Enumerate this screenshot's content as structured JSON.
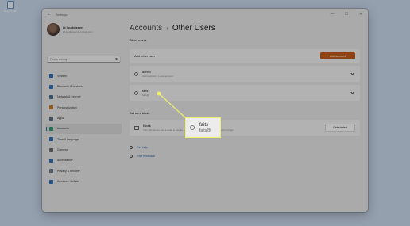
{
  "desktop": {
    "recycle_bin_label": "Recycle Bin",
    "recycle_bin_icon": "recycle-bin-icon"
  },
  "window": {
    "title": "Settings",
    "controls": {
      "minimize": "—",
      "maximize": "☐",
      "close": "✕"
    },
    "back": "←"
  },
  "profile": {
    "name": "jd loudoizeen",
    "email": "jdl.loudoizeen@outlook.com"
  },
  "search": {
    "placeholder": "Find a setting"
  },
  "nav": {
    "items": [
      {
        "label": "System",
        "icon": "monitor-icon",
        "color": "#2e6fb5"
      },
      {
        "label": "Bluetooth & devices",
        "icon": "bluetooth-icon",
        "color": "#2e6fb5"
      },
      {
        "label": "Network & internet",
        "icon": "wifi-icon",
        "color": "#4a6b8a"
      },
      {
        "label": "Personalization",
        "icon": "brush-icon",
        "color": "#c07a2a"
      },
      {
        "label": "Apps",
        "icon": "apps-icon",
        "color": "#5a6b7c"
      },
      {
        "label": "Accounts",
        "icon": "person-icon",
        "color": "#2e9a6e",
        "active": true
      },
      {
        "label": "Time & language",
        "icon": "clock-globe-icon",
        "color": "#2e6fb5"
      },
      {
        "label": "Gaming",
        "icon": "controller-icon",
        "color": "#6b6b6b"
      },
      {
        "label": "Accessibility",
        "icon": "accessibility-icon",
        "color": "#2e6fb5"
      },
      {
        "label": "Privacy & security",
        "icon": "shield-icon",
        "color": "#6b7b8b"
      },
      {
        "label": "Windows Update",
        "icon": "update-icon",
        "color": "#2e6fb5"
      }
    ]
  },
  "header": {
    "parent": "Accounts",
    "separator": "›",
    "current": "Other Users"
  },
  "other_users": {
    "label": "Other users",
    "add_other_user": "Add other user",
    "add_account_button": "Add account",
    "users": [
      {
        "name": "admin",
        "sub": "Administrator - Local account"
      },
      {
        "name": "faits",
        "sub": "faits@"
      }
    ]
  },
  "kiosk": {
    "label": "Set up a kiosk",
    "title": "Kiosk",
    "description": "Turn this device into a kiosk to use as a digital sign, interactive display, or other things",
    "button": "Get started"
  },
  "links": {
    "get_help": "Get help",
    "give_feedback": "Give feedback"
  },
  "callout": {
    "name": "faits",
    "email": "faits@",
    "border_color": "#eef06a"
  },
  "colors": {
    "accent": "#c25a1a",
    "highlight": "#eef06a",
    "nav_active_indicator": "#2e6fb5"
  }
}
